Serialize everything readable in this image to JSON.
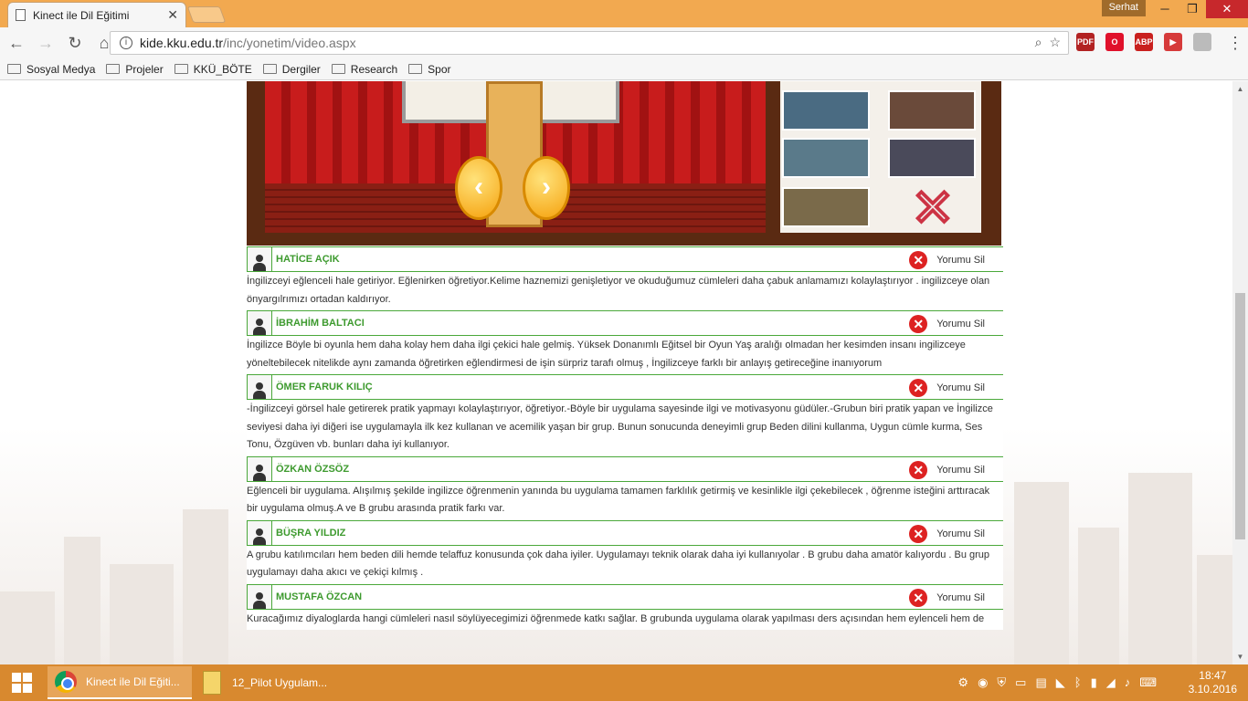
{
  "browser": {
    "tab_title": "Kinect ile Dil Eğitimi",
    "tab_close": "✕",
    "user": "Serhat",
    "url_host": "kide.kku.edu.tr",
    "url_path": "/inc/yonetim/video.aspx",
    "window_controls": {
      "minimize": "─",
      "maximize": "❐",
      "close": "✕"
    },
    "extensions": [
      {
        "name": "pdf-extension-icon",
        "label": "PDF",
        "color": "#b22222"
      },
      {
        "name": "opera-extension-icon",
        "label": "O",
        "color": "#e0112b"
      },
      {
        "name": "adblock-extension-icon",
        "label": "ABP",
        "color": "#c9201e"
      },
      {
        "name": "media-extension-icon",
        "label": "▶",
        "color": "#d63a3a"
      }
    ]
  },
  "bookmarks": [
    "Sosyal Medya",
    "Projeler",
    "KKÜ_BÖTE",
    "Dergiler",
    "Research",
    "Spor"
  ],
  "comments": [
    {
      "name": "HATİCE AÇIK",
      "delete_label": "Yorumu Sil",
      "text": "İngilizceyi eğlenceli hale getiriyor. Eğlenirken öğretiyor.Kelime haznemizi genişletiyor ve okuduğumuz cümleleri daha çabuk anlamamızı kolaylaştırıyor . ingilizceye olan önyargılrımızı ortadan kaldırıyor."
    },
    {
      "name": "İBRAHİM BALTACI",
      "delete_label": "Yorumu Sil",
      "text": "İngilizce Böyle bi oyunla hem daha kolay hem daha ilgi çekici hale gelmiş. Yüksek Donanımlı Eğitsel bir Oyun Yaş aralığı olmadan her kesimden insanı ingilizceye yöneltebilecek nitelikde aynı zamanda öğretirken eğlendirmesi de işin sürpriz tarafı olmuş , İngilizceye farklı bir anlayış getireceğine inanıyorum"
    },
    {
      "name": "ÖMER FARUK KILIÇ",
      "delete_label": "Yorumu Sil",
      "text": "-İngilizceyi görsel hale getirerek pratik yapmayı kolaylaştırıyor, öğretiyor.-Böyle bir uygulama sayesinde ilgi ve motivasyonu güdüler.-Grubun biri pratik yapan ve İngilizce seviyesi daha iyi diğeri ise uygulamayla ilk kez kullanan ve acemilik yaşan bir grup. Bunun sonucunda deneyimli grup Beden dilini kullanma, Uygun cümle kurma, Ses Tonu, Özgüven vb. bunları daha iyi kullanıyor."
    },
    {
      "name": "ÖZKAN ÖZSÖZ",
      "delete_label": "Yorumu Sil",
      "text": "Eğlenceli bir uygulama. Alışılmış şekilde ingilizce öğrenmenin yanında bu uygulama tamamen farklılık getirmiş ve kesinlikle ilgi çekebilecek , öğrenme isteğini arttıracak bir uygulama olmuş.A ve B grubu arasında pratik farkı var."
    },
    {
      "name": "BÜŞRA YILDIZ",
      "delete_label": "Yorumu Sil",
      "text": "A grubu katılımcıları hem beden dili hemde telaffuz konusunda çok daha iyiler. Uygulamayı teknik olarak daha iyi kullanıyolar . B grubu daha amatör kalıyordu . Bu grup uygulamayı daha akıcı ve çekiçi kılmış ."
    },
    {
      "name": "MUSTAFA ÖZCAN",
      "delete_label": "Yorumu Sil",
      "text": "Kuracağımız diyaloglarda hangi cümleleri nasıl söylüyecegimizi öğrenmede katkı sağlar. B grubunda uygulama olarak yapılması ders açısından hem eylenceli hem de"
    }
  ],
  "taskbar": {
    "tasks": [
      {
        "label": "Kinect ile Dil Eğiti..."
      },
      {
        "label": "12_Pilot Uygulam..."
      }
    ],
    "time": "18:47",
    "date": "3.10.2016"
  },
  "colors": {
    "accent": "#3d9a2e",
    "titlebar": "#f2a950",
    "taskbar": "#d8892f"
  }
}
